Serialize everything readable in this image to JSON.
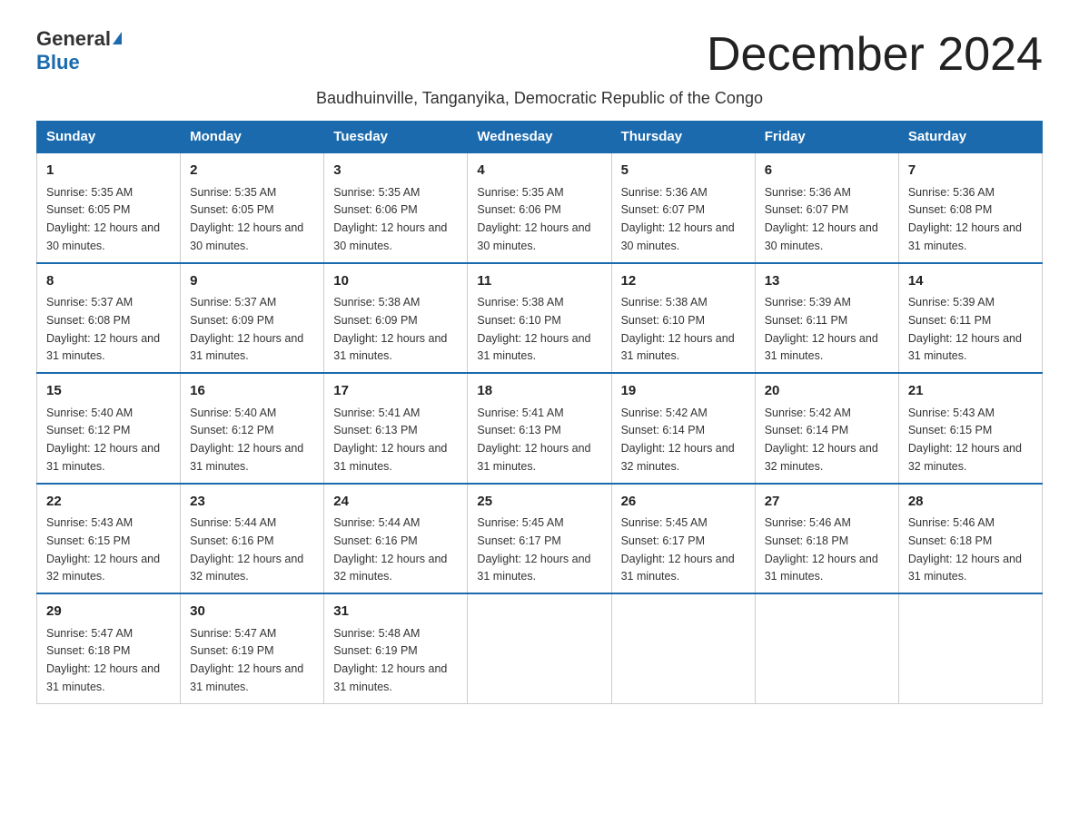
{
  "header": {
    "logo_general": "General",
    "logo_blue": "Blue",
    "month_title": "December 2024",
    "subtitle": "Baudhuinville, Tanganyika, Democratic Republic of the Congo"
  },
  "days_of_week": [
    "Sunday",
    "Monday",
    "Tuesday",
    "Wednesday",
    "Thursday",
    "Friday",
    "Saturday"
  ],
  "weeks": [
    [
      {
        "num": "1",
        "sunrise": "5:35 AM",
        "sunset": "6:05 PM",
        "daylight": "12 hours and 30 minutes."
      },
      {
        "num": "2",
        "sunrise": "5:35 AM",
        "sunset": "6:05 PM",
        "daylight": "12 hours and 30 minutes."
      },
      {
        "num": "3",
        "sunrise": "5:35 AM",
        "sunset": "6:06 PM",
        "daylight": "12 hours and 30 minutes."
      },
      {
        "num": "4",
        "sunrise": "5:35 AM",
        "sunset": "6:06 PM",
        "daylight": "12 hours and 30 minutes."
      },
      {
        "num": "5",
        "sunrise": "5:36 AM",
        "sunset": "6:07 PM",
        "daylight": "12 hours and 30 minutes."
      },
      {
        "num": "6",
        "sunrise": "5:36 AM",
        "sunset": "6:07 PM",
        "daylight": "12 hours and 30 minutes."
      },
      {
        "num": "7",
        "sunrise": "5:36 AM",
        "sunset": "6:08 PM",
        "daylight": "12 hours and 31 minutes."
      }
    ],
    [
      {
        "num": "8",
        "sunrise": "5:37 AM",
        "sunset": "6:08 PM",
        "daylight": "12 hours and 31 minutes."
      },
      {
        "num": "9",
        "sunrise": "5:37 AM",
        "sunset": "6:09 PM",
        "daylight": "12 hours and 31 minutes."
      },
      {
        "num": "10",
        "sunrise": "5:38 AM",
        "sunset": "6:09 PM",
        "daylight": "12 hours and 31 minutes."
      },
      {
        "num": "11",
        "sunrise": "5:38 AM",
        "sunset": "6:10 PM",
        "daylight": "12 hours and 31 minutes."
      },
      {
        "num": "12",
        "sunrise": "5:38 AM",
        "sunset": "6:10 PM",
        "daylight": "12 hours and 31 minutes."
      },
      {
        "num": "13",
        "sunrise": "5:39 AM",
        "sunset": "6:11 PM",
        "daylight": "12 hours and 31 minutes."
      },
      {
        "num": "14",
        "sunrise": "5:39 AM",
        "sunset": "6:11 PM",
        "daylight": "12 hours and 31 minutes."
      }
    ],
    [
      {
        "num": "15",
        "sunrise": "5:40 AM",
        "sunset": "6:12 PM",
        "daylight": "12 hours and 31 minutes."
      },
      {
        "num": "16",
        "sunrise": "5:40 AM",
        "sunset": "6:12 PM",
        "daylight": "12 hours and 31 minutes."
      },
      {
        "num": "17",
        "sunrise": "5:41 AM",
        "sunset": "6:13 PM",
        "daylight": "12 hours and 31 minutes."
      },
      {
        "num": "18",
        "sunrise": "5:41 AM",
        "sunset": "6:13 PM",
        "daylight": "12 hours and 31 minutes."
      },
      {
        "num": "19",
        "sunrise": "5:42 AM",
        "sunset": "6:14 PM",
        "daylight": "12 hours and 32 minutes."
      },
      {
        "num": "20",
        "sunrise": "5:42 AM",
        "sunset": "6:14 PM",
        "daylight": "12 hours and 32 minutes."
      },
      {
        "num": "21",
        "sunrise": "5:43 AM",
        "sunset": "6:15 PM",
        "daylight": "12 hours and 32 minutes."
      }
    ],
    [
      {
        "num": "22",
        "sunrise": "5:43 AM",
        "sunset": "6:15 PM",
        "daylight": "12 hours and 32 minutes."
      },
      {
        "num": "23",
        "sunrise": "5:44 AM",
        "sunset": "6:16 PM",
        "daylight": "12 hours and 32 minutes."
      },
      {
        "num": "24",
        "sunrise": "5:44 AM",
        "sunset": "6:16 PM",
        "daylight": "12 hours and 32 minutes."
      },
      {
        "num": "25",
        "sunrise": "5:45 AM",
        "sunset": "6:17 PM",
        "daylight": "12 hours and 31 minutes."
      },
      {
        "num": "26",
        "sunrise": "5:45 AM",
        "sunset": "6:17 PM",
        "daylight": "12 hours and 31 minutes."
      },
      {
        "num": "27",
        "sunrise": "5:46 AM",
        "sunset": "6:18 PM",
        "daylight": "12 hours and 31 minutes."
      },
      {
        "num": "28",
        "sunrise": "5:46 AM",
        "sunset": "6:18 PM",
        "daylight": "12 hours and 31 minutes."
      }
    ],
    [
      {
        "num": "29",
        "sunrise": "5:47 AM",
        "sunset": "6:18 PM",
        "daylight": "12 hours and 31 minutes."
      },
      {
        "num": "30",
        "sunrise": "5:47 AM",
        "sunset": "6:19 PM",
        "daylight": "12 hours and 31 minutes."
      },
      {
        "num": "31",
        "sunrise": "5:48 AM",
        "sunset": "6:19 PM",
        "daylight": "12 hours and 31 minutes."
      },
      null,
      null,
      null,
      null
    ]
  ]
}
